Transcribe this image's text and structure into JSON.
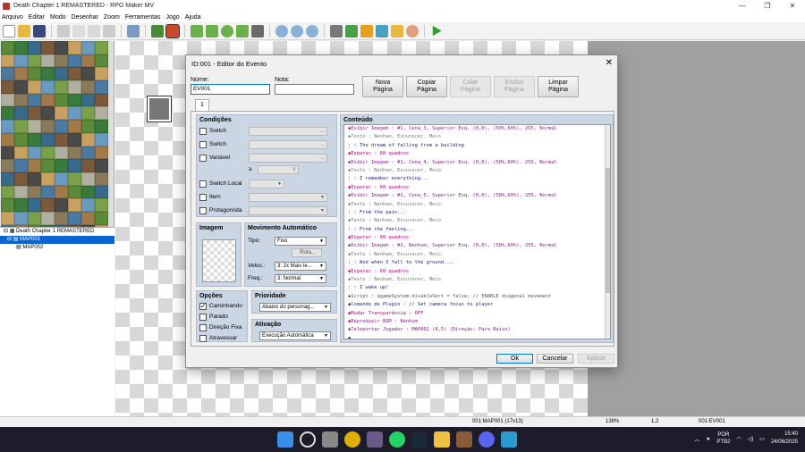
{
  "window": {
    "title": "Death Chapter 1 REMASTERED - RPG Maker MV",
    "min": "—",
    "max": "❐",
    "close": "✕"
  },
  "menu": [
    "Arquivo",
    "Editar",
    "Modo",
    "Desenhar",
    "Zoom",
    "Ferramentas",
    "Jogo",
    "Ajuda"
  ],
  "tileset_tabs": [
    "A",
    "B",
    "C",
    "R"
  ],
  "tileset_selected_tab": "C",
  "map_tree": [
    {
      "label": "Death Chapter 1 REMASTERED",
      "level": 0
    },
    {
      "label": "MAP001",
      "level": 1,
      "selected": true
    },
    {
      "label": "MAP002",
      "level": 2
    }
  ],
  "status": {
    "map": "001:MAP001 (17x13)",
    "zoom": "138%",
    "coords": "1,2",
    "event": "001:EV001"
  },
  "taskbar": {
    "lang1": "POR",
    "lang2": "PTB2",
    "time": "15:40",
    "date": "24/06/2025",
    "badge": "5"
  },
  "dialog": {
    "title": "ID:001 - Editor do Evento",
    "close": "✕",
    "name_label": "Nome:",
    "name_value": "EV001",
    "note_label": "Nota:",
    "note_value": "",
    "btn_new_page": "Nova\nPágina",
    "btn_copy_page": "Copiar\nPágina",
    "btn_paste_page": "Colar\nPágina",
    "btn_delete_page": "Excluir\nPágina",
    "btn_clear_page": "Limpar\nPágina",
    "page_tab": "1",
    "conditions": {
      "title": "Condições",
      "switch1": "Switch",
      "switch2": "Switch",
      "variable": "Variável",
      "ge": "≥",
      "self_switch": "Switch Local",
      "item": "Item",
      "actor": "Protagonista",
      "ellipsis": "..."
    },
    "image": {
      "title": "Imagem"
    },
    "autonomous": {
      "title": "Movimento Automático",
      "type_label": "Tipo:",
      "type_value": "Fixo",
      "route_btn": "Rota...",
      "speed_label": "Veloc.:",
      "speed_value": "3: 2x Mais le...",
      "freq_label": "Freq.:",
      "freq_value": "3: Normal"
    },
    "options": {
      "title": "Opções",
      "walking": "Caminhando",
      "stepping": "Parado",
      "direction_fix": "Direção Fixa",
      "through": "Atravessar"
    },
    "priority": {
      "title": "Prioridade",
      "value": "Abaixo do personag..."
    },
    "trigger": {
      "title": "Ativação",
      "value": "Execução Automática"
    },
    "content": {
      "title": "Conteúdo",
      "lines": [
        {
          "t": "◆Exibir Imagem : #1, Cena_3, Superior Esq. (0,0), (50%,60%), 255, Normal",
          "c": "#8b1a8b"
        },
        {
          "t": "◆Texto : Nenhum, Escurecer, Meio",
          "c": "#7a7a7a"
        },
        {
          "t": " :        : The dream of falling from a building",
          "c": "#1c1c8a"
        },
        {
          "t": "◆Esperar : 60 quadros",
          "c": "#b8007a"
        },
        {
          "t": "◆Exibir Imagem : #1, Cena_4, Superior Esq. (0,0), (50%,60%), 255, Normal",
          "c": "#8b1a8b"
        },
        {
          "t": "◆Texto : Nenhum, Escurecer, Meio",
          "c": "#7a7a7a"
        },
        {
          "t": " :        : I remember everything...",
          "c": "#1c1c8a"
        },
        {
          "t": "◆Esperar : 60 quadros",
          "c": "#b8007a"
        },
        {
          "t": "◆Exibir Imagem : #1, Cena_5, Superior Esq. (0,0), (50%,60%), 255, Normal",
          "c": "#8b1a8b"
        },
        {
          "t": "◆Texto : Nenhum, Escurecer, Meio",
          "c": "#7a7a7a"
        },
        {
          "t": " :        : From the pain...",
          "c": "#1c1c8a"
        },
        {
          "t": "◆Texto : Nenhum, Escurecer, Meio",
          "c": "#7a7a7a"
        },
        {
          "t": " :        : From the feeling...",
          "c": "#1c1c8a"
        },
        {
          "t": "◆Esperar : 60 quadros",
          "c": "#b8007a"
        },
        {
          "t": "◆Exibir Imagem : #1, Nenhum, Superior Esq. (0,0), (50%,60%), 255, Normal",
          "c": "#8b1a8b"
        },
        {
          "t": "◆Texto : Nenhum, Escurecer, Meio",
          "c": "#7a7a7a"
        },
        {
          "t": " :        : And when I fall to the ground...",
          "c": "#1c1c8a"
        },
        {
          "t": "◆Esperar : 60 quadros",
          "c": "#b8007a"
        },
        {
          "t": "◆Texto : Nenhum, Escurecer, Meio",
          "c": "#7a7a7a"
        },
        {
          "t": " :        : I wake up!",
          "c": "#1c1c8a"
        },
        {
          "t": "◆Script : $gameSystem.disableVert = false;  // ENABLE diagonal movement",
          "c": "#555555"
        },
        {
          "t": "◆Comando de Plugin : // Set camera focus to player",
          "c": "#1c1c8a"
        },
        {
          "t": "◆Mudar Transparência : OFF",
          "c": "#b8007a"
        },
        {
          "t": "◆Reproduzir BGM : Nenhum",
          "c": "#8b1a8b"
        },
        {
          "t": "◆Teleportar Jogador : MAP002 (8,5) (Direção: Para Baixo)",
          "c": "#8b1a8b"
        },
        {
          "t": "◆",
          "c": "#000000"
        }
      ]
    },
    "btn_ok": "Ok",
    "btn_cancel": "Cancelar",
    "btn_apply": "Aplicar"
  }
}
